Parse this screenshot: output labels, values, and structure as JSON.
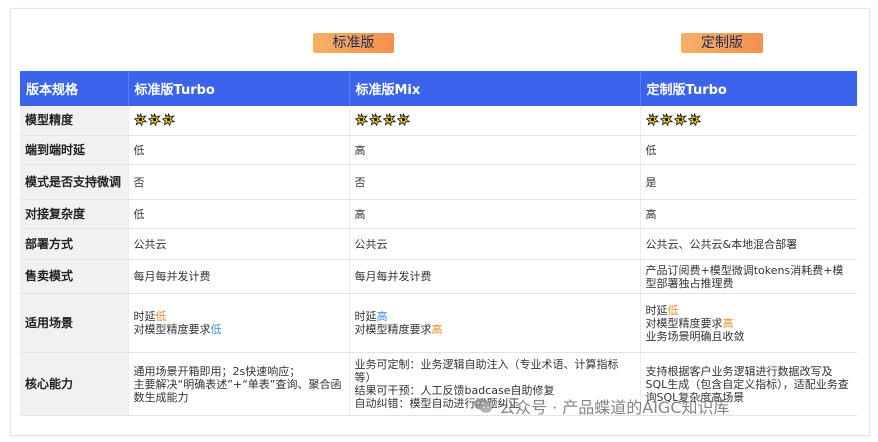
{
  "badges": {
    "standard": "标准版",
    "custom": "定制版"
  },
  "colors": {
    "header_bg": "#3b63ec",
    "badge": "#f39c52",
    "accent_orange": "#f08a24",
    "accent_blue": "#3d8ef0"
  },
  "table": {
    "headers": [
      "版本规格",
      "标准版Turbo",
      "标准版Mix",
      "定制版Turbo"
    ],
    "rows": [
      {
        "label": "模型精度",
        "stars": [
          3,
          4,
          4
        ]
      },
      {
        "label": "端到端时延",
        "cells": [
          "低",
          "高",
          "低"
        ]
      },
      {
        "label": "模式是否支持微调",
        "cells": [
          "否",
          "否",
          "是"
        ]
      },
      {
        "label": "对接复杂度",
        "cells": [
          "低",
          "高",
          "高"
        ]
      },
      {
        "label": "部署方式",
        "cells": [
          "公共云",
          "公共云",
          "公共云、公共云&本地混合部署"
        ]
      },
      {
        "label": "售卖模式",
        "cells": [
          "每月每并发计费",
          "每月每并发计费",
          "产品订阅费+模型微调tokens消耗费+模型部署独占推理费"
        ]
      },
      {
        "label": "适用场景",
        "c1": {
          "l1a": "时延",
          "l1b": "低",
          "l2a": "对模型精度要求",
          "l2b": "低"
        },
        "c2": {
          "l1a": "时延",
          "l1b": "高",
          "l2a": "对模型精度要求",
          "l2b": "高"
        },
        "c3": {
          "l1a": "时延",
          "l1b": "低",
          "l2a": "对模型精度要求",
          "l2b": "高",
          "l3": "业务场景明确且收敛"
        }
      },
      {
        "label": "核心能力",
        "c1": [
          "通用场景开箱即用；2s快速响应；",
          "主要解决“明确表述”+“单表”查询、聚合函数生成能力"
        ],
        "c2": [
          "业务可定制：业务逻辑自助注入（专业术语、计算指标等）",
          "结果可干预：人工反馈badcase自助修复",
          "自动纠错：模型自动进行问题纠正"
        ],
        "c3": [
          "支持根据客户业务逻辑进行数据改写及SQL生成（包含自定义指标），适配业务查询SQL复杂度高场景"
        ]
      }
    ]
  },
  "watermark": {
    "text": "公众号 · 产品蝶道的AIGC知识库",
    "icon": "wechat-icon"
  }
}
